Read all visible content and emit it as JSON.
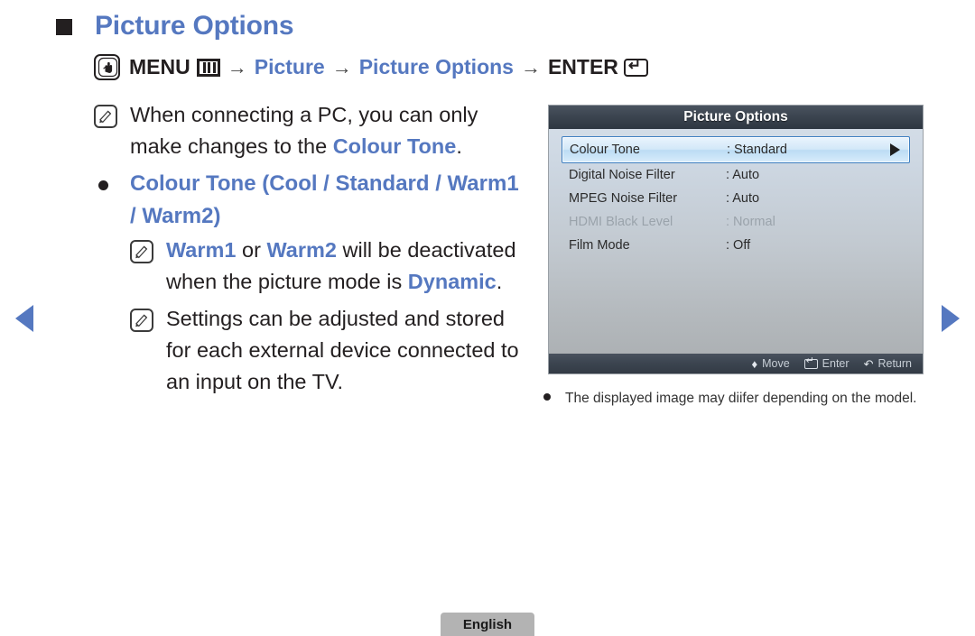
{
  "nav": {
    "prev_label": "previous page",
    "next_label": "next page"
  },
  "heading": {
    "title": "Picture Options"
  },
  "menu_path": {
    "hand_icon": "hand-press-icon",
    "menu_label": "MENU",
    "menu_bars_icon": "menu-bars-icon",
    "arrow1": "→",
    "picture_label": "Picture",
    "arrow2": "→",
    "picture_options_label": "Picture Options",
    "arrow3": "→",
    "enter_label": "ENTER",
    "enter_icon": "enter-key-icon"
  },
  "notes": [
    {
      "icon": "note-pencil-icon",
      "segments": [
        {
          "text": "When connecting a PC, you can only make changes to the ",
          "style": "plain"
        },
        {
          "text": "Colour Tone",
          "style": "blue"
        },
        {
          "text": ".",
          "style": "plain"
        }
      ]
    }
  ],
  "note1": {
    "line1_plain_a": "When connecting a PC, you can only",
    "line2_plain_a": "make changes to the ",
    "line2_blue": "Colour Tone",
    "line2_plain_b": "."
  },
  "bullet": {
    "text": "Colour Tone (Cool / Standard / Warm1 / Warm2)"
  },
  "note2": {
    "blue_a": "Warm1",
    "plain_a": " or ",
    "blue_b": "Warm2",
    "plain_b": " will be deactivated when the picture mode is ",
    "blue_c": "Dynamic",
    "plain_c": "."
  },
  "note3": {
    "text": "Settings can be adjusted and stored for each external device connected to an input on the TV."
  },
  "osd": {
    "title": "Picture Options",
    "rows": [
      {
        "label": "Colour Tone",
        "value": ": Standard",
        "state": "selected"
      },
      {
        "label": "Digital Noise Filter",
        "value": ": Auto",
        "state": "normal"
      },
      {
        "label": "MPEG Noise Filter",
        "value": ": Auto",
        "state": "normal"
      },
      {
        "label": "HDMI Black Level",
        "value": ": Normal",
        "state": "disabled"
      },
      {
        "label": "Film Mode",
        "value": ": Off",
        "state": "normal"
      }
    ],
    "footer": {
      "move_icon": "up-down-arrow-icon",
      "move_label": "Move",
      "enter_icon": "enter-key-icon",
      "enter_label": "Enter",
      "return_icon": "return-arrow-icon",
      "return_label": "Return"
    }
  },
  "caption": {
    "text": "The displayed image may diifer depending on the model."
  },
  "footer": {
    "language": "English"
  },
  "colors": {
    "accent_blue": "#5578c0",
    "text_black": "#231f20",
    "osd_titlebar": "#3c4550",
    "osd_highlight_border": "#3f7fc1",
    "badge_gray": "#b3b3b3"
  }
}
